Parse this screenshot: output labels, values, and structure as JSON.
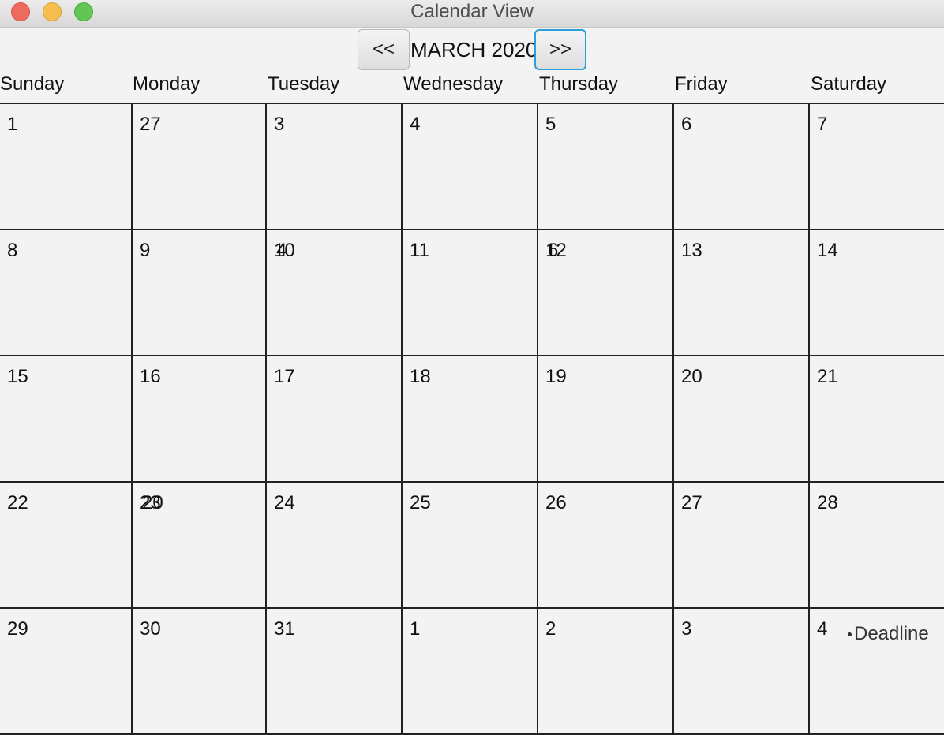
{
  "window": {
    "title": "Calendar View"
  },
  "nav": {
    "prev_label": "<<",
    "next_label": ">>",
    "month_label": "MARCH 2020"
  },
  "weekdays": [
    "Sunday",
    "Monday",
    "Tuesday",
    "Wednesday",
    "Thursday",
    "Friday",
    "Saturday"
  ],
  "weeks": [
    [
      {
        "day": "1"
      },
      {
        "day": "27"
      },
      {
        "day": "3"
      },
      {
        "day": "4"
      },
      {
        "day": "5"
      },
      {
        "day": "6"
      },
      {
        "day": "7"
      }
    ],
    [
      {
        "day": "8"
      },
      {
        "day": "9"
      },
      {
        "day": "10",
        "overlay": "4"
      },
      {
        "day": "11"
      },
      {
        "day": "12",
        "overlay": "6"
      },
      {
        "day": "13"
      },
      {
        "day": "14"
      }
    ],
    [
      {
        "day": "15"
      },
      {
        "day": "16"
      },
      {
        "day": "17"
      },
      {
        "day": "18"
      },
      {
        "day": "19"
      },
      {
        "day": "20"
      },
      {
        "day": "21"
      }
    ],
    [
      {
        "day": "22"
      },
      {
        "day": "23",
        "overlay": "20"
      },
      {
        "day": "24"
      },
      {
        "day": "25"
      },
      {
        "day": "26"
      },
      {
        "day": "27"
      },
      {
        "day": "28"
      }
    ],
    [
      {
        "day": "29"
      },
      {
        "day": "30"
      },
      {
        "day": "31"
      },
      {
        "day": "1"
      },
      {
        "day": "2"
      },
      {
        "day": "3"
      },
      {
        "day": "4",
        "event": "Deadline"
      }
    ]
  ],
  "colors": {
    "background": "#f3f3f3",
    "grid_line": "#222222",
    "focus_ring": "#2a9fd9",
    "close": "#ee6a5e",
    "minimize": "#f5be4f",
    "zoom": "#62c655"
  }
}
